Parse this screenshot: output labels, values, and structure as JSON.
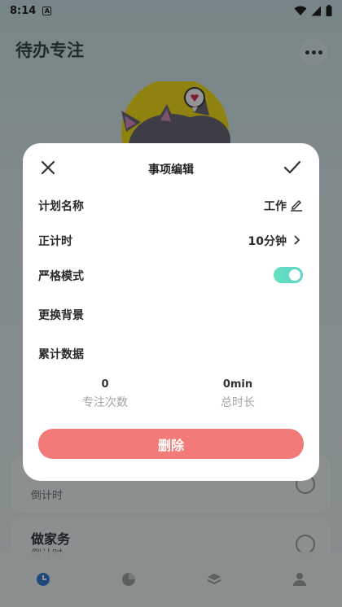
{
  "status_bar": {
    "time": "8:14",
    "notification_letter": "A"
  },
  "app": {
    "title": "待办专注"
  },
  "background_tasks": [
    {
      "title": "",
      "subtitle": "倒计时"
    },
    {
      "title": "做家务",
      "subtitle": "倒计时"
    }
  ],
  "modal": {
    "title": "事项编辑",
    "rows": {
      "plan_name": {
        "label": "计划名称",
        "value": "工作"
      },
      "timing": {
        "label": "正计时",
        "value": "10分钟"
      },
      "strict_mode": {
        "label": "严格模式",
        "enabled": true
      },
      "change_background": {
        "label": "更换背景"
      },
      "stats": {
        "label": "累计数据"
      }
    },
    "stats": {
      "focus_count": {
        "value": "0",
        "caption": "专注次数"
      },
      "total_duration": {
        "value": "0min",
        "caption": "总时长"
      }
    },
    "delete_label": "删除"
  },
  "colors": {
    "delete_button": "#f27b7a",
    "toggle_on": "#63e1c0"
  }
}
